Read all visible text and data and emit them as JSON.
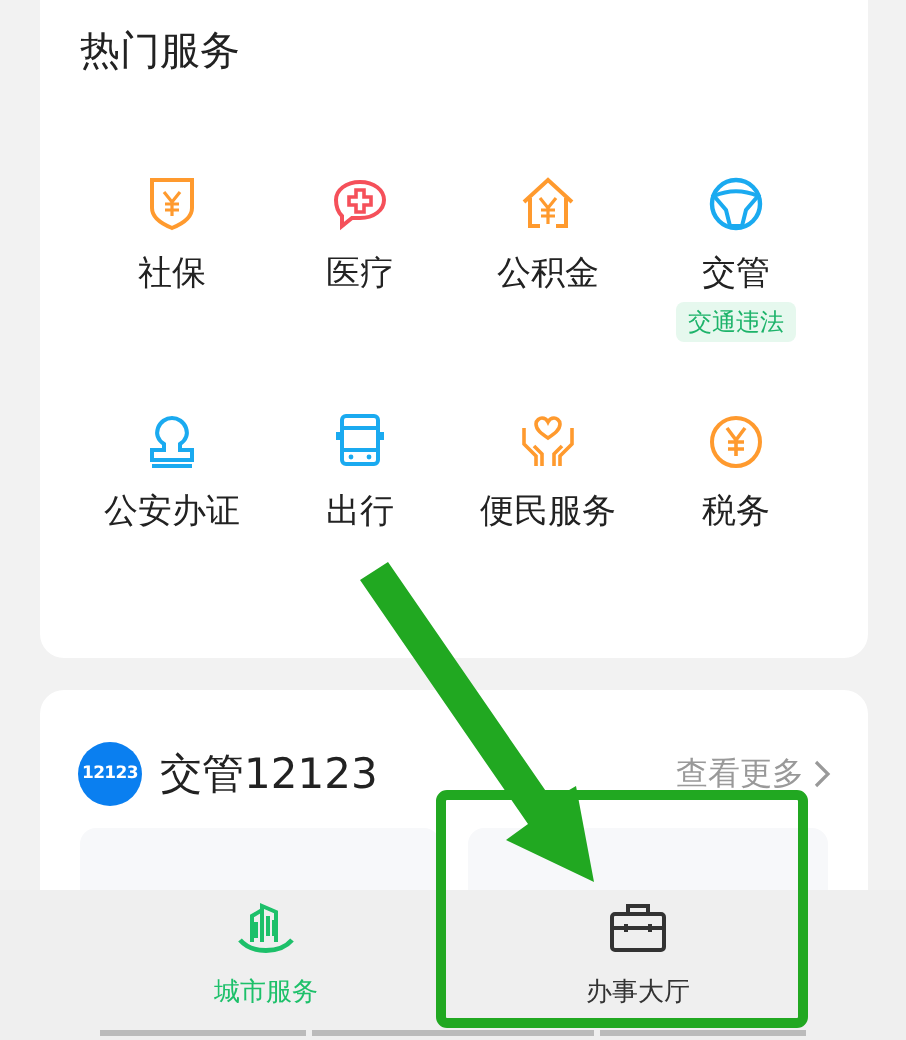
{
  "hot_services": {
    "title": "热门服务",
    "items": [
      {
        "label": "社保"
      },
      {
        "label": "医疗"
      },
      {
        "label": "公积金"
      },
      {
        "label": "交管",
        "badge": "交通违法"
      },
      {
        "label": "公安办证"
      },
      {
        "label": "出行"
      },
      {
        "label": "便民服务"
      },
      {
        "label": "税务"
      }
    ]
  },
  "traffic_card": {
    "logo_text": "12123",
    "title": "交管12123",
    "more": "查看更多"
  },
  "tabs": [
    {
      "label": "城市服务",
      "selected": true
    },
    {
      "label": "办事大厅",
      "selected": false
    }
  ]
}
